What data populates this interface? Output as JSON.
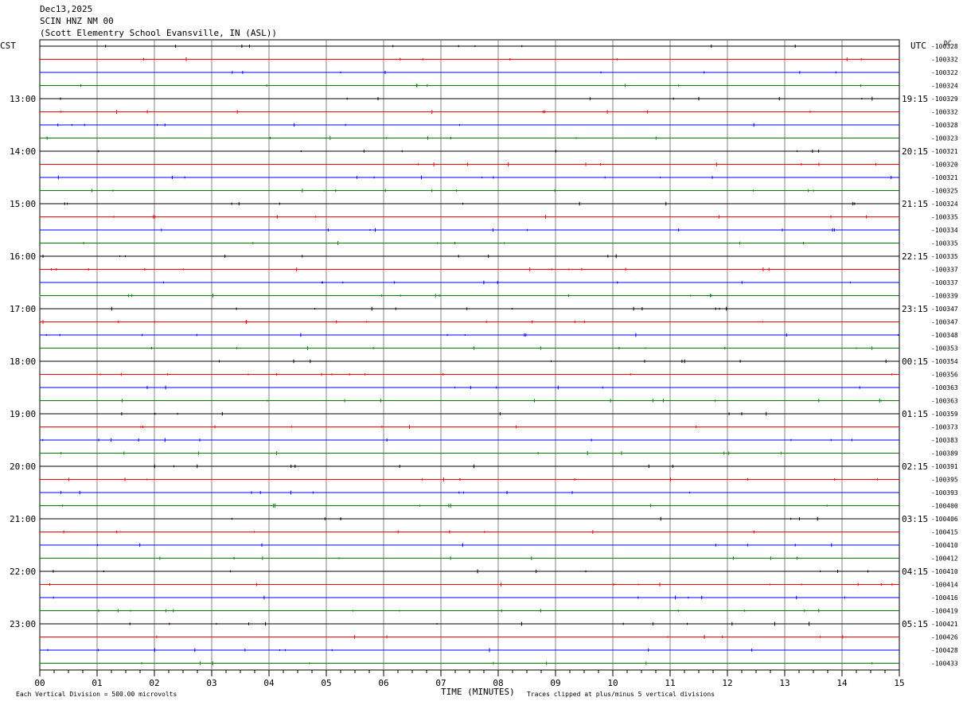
{
  "header": {
    "date": "Dec13,2025",
    "station": "SCIN HNZ NM 00",
    "location": "(Scott Elementry School Evansville, IN (ASL))"
  },
  "chart_data": {
    "type": "line",
    "title": "SCIN HNZ NM 00",
    "left_timezone_label": "CST",
    "right_timezone_label": "UTC",
    "dc_label": "DC",
    "xlabel": "TIME (MINUTES)",
    "xlim": [
      0,
      15
    ],
    "x_ticks": [
      "00",
      "01",
      "02",
      "03",
      "04",
      "05",
      "06",
      "07",
      "08",
      "09",
      "10",
      "11",
      "12",
      "13",
      "14",
      "15"
    ],
    "cst_hour_labels": [
      "13:00",
      "14:00",
      "15:00",
      "16:00",
      "17:00",
      "18:00",
      "19:00",
      "20:00",
      "21:00",
      "22:00",
      "23:00"
    ],
    "utc_hour_labels": [
      "19:15",
      "20:15",
      "21:15",
      "22:15",
      "23:15",
      "00:15",
      "01:15",
      "02:15",
      "03:15",
      "04:15",
      "05:15"
    ],
    "trace_color_cycle": [
      "#000000",
      "#ff0000",
      "#0000ff",
      "#008000"
    ],
    "dc_offsets": [
      "-100328",
      "-100332",
      "-100322",
      "-100324",
      "-100329",
      "-100332",
      "-100328",
      "-100323",
      "-100321",
      "-100320",
      "-100321",
      "-100325",
      "-100324",
      "-100335",
      "-100334",
      "-100335",
      "-100335",
      "-100337",
      "-100337",
      "-100339",
      "-100347",
      "-100347",
      "-100348",
      "-100353",
      "-100354",
      "-100356",
      "-100363",
      "-100363",
      "-100359",
      "-100373",
      "-100383",
      "-100389",
      "-100391",
      "-100395",
      "-100393",
      "-100400",
      "-100406",
      "-100415",
      "-100410",
      "-100412",
      "-100410",
      "-100414",
      "-100416",
      "-100419",
      "-100421",
      "-100426",
      "-100428",
      "-100433"
    ],
    "footer_left": "Each Vertical Division =  500.00 microvolts",
    "footer_right": "Traces clipped at plus/minus 5 vertical divisions",
    "grid": true
  }
}
